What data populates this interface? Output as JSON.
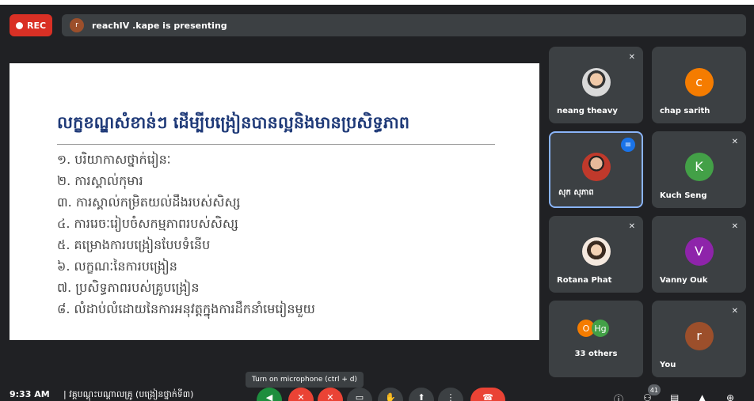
{
  "rec_label": "REC",
  "presenter": {
    "initial": "r",
    "text": "reachIV .kape is presenting"
  },
  "slide": {
    "title": "លក្ខខណ្ឌសំខាន់ៗ ដើម្បីបង្រៀនបានល្អនិងមានប្រសិទ្ធភាព",
    "items": [
      "១. បរិយាកាសថ្នាក់រៀនៈ",
      "២. ការស្គាល់កុមារ",
      "៣. ការស្គាល់កម្រិតយល់ដឹងរបស់សិស្ស",
      "៤. ការរេចៈរៀបចំសកម្មភាពរបស់សិស្ស",
      "៥. គម្រោងការបង្រៀនបែបទំនើប",
      "៦. លក្ខណៈនៃការបង្រៀន",
      "៧. ប្រសិទ្ធភាពរបស់គ្រូបង្រៀន",
      "៨. លំដាប់លំដោយនៃការអនុវត្តក្នុងការដឹកនាំមេរៀនមួយ"
    ]
  },
  "participants": [
    {
      "name": "neang theavy",
      "avatar": "photo",
      "muted": true
    },
    {
      "name": "chap sarith",
      "initial": "c",
      "color": "#f57c00",
      "muted": false
    },
    {
      "name": "សុក សុភាព",
      "avatar": "photo-red",
      "speaking": true
    },
    {
      "name": "Kuch Seng",
      "initial": "K",
      "color": "#43a047",
      "muted": true
    },
    {
      "name": "Rotana Phat",
      "avatar": "photo-woman",
      "muted": true
    },
    {
      "name": "Vanny Ouk",
      "initial": "V",
      "color": "#8e24aa",
      "muted": true
    },
    {
      "name": "33 others",
      "mini": [
        "O",
        "Hg"
      ],
      "mini_colors": [
        "#f57c00",
        "#43a047"
      ]
    },
    {
      "name": "You",
      "initial": "r",
      "color": "#9c4f2b",
      "muted": true
    }
  ],
  "bottom": {
    "time": "9:33 AM",
    "meeting": "| វគ្គបណ្តុះបណ្តាលគ្រូ (បង្រៀនថ្នាក់ទី៣)",
    "tooltip": "Turn on microphone (ctrl + d)",
    "participant_count": "41"
  },
  "icons": {
    "mute": "mic-off-icon",
    "speaking": "audio-level-icon"
  }
}
